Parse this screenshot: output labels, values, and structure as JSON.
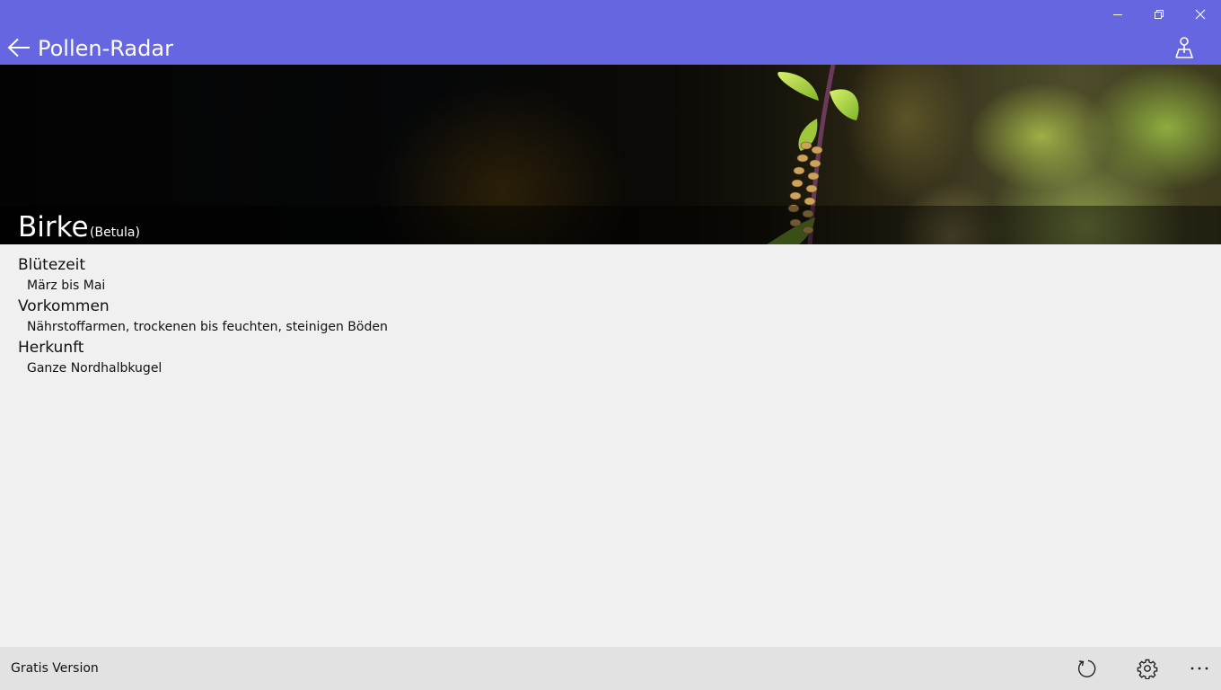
{
  "header": {
    "app_title": "Pollen-Radar",
    "background_color": "#6666e0",
    "icons": {
      "back": "back-arrow-icon",
      "location": "location-map-icon",
      "minimize": "minimize-icon",
      "restore": "restore-icon",
      "close": "close-icon"
    }
  },
  "hero": {
    "plant_name": "Birke",
    "latin_name": "(Betula)"
  },
  "details": [
    {
      "title": "Blütezeit",
      "value": "März bis Mai"
    },
    {
      "title": "Vorkommen",
      "value": "Nährstoffarmen, trockenen bis feuchten, steinigen Böden"
    },
    {
      "title": "Herkunft",
      "value": "Ganze Nordhalbkugel"
    }
  ],
  "bottom_bar": {
    "version_label": "Gratis Version",
    "icons": {
      "refresh": "refresh-icon",
      "settings": "gear-icon",
      "more": "more-ellipsis-icon"
    }
  }
}
